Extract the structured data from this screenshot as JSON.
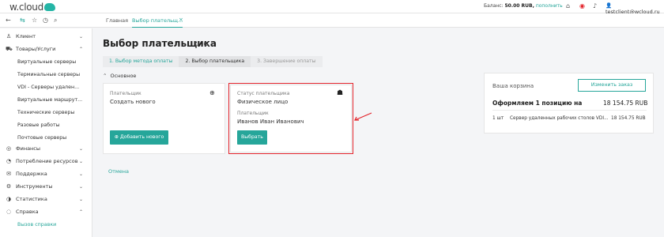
{
  "header": {
    "logo": "w.cloud",
    "balance_label": "Баланс:",
    "balance_value": "50.00 RUB,",
    "topup_link": "пополнить",
    "user_email": "testclient@wcloud.ru",
    "icons": [
      "home-icon",
      "warning-icon",
      "bell-icon",
      "user-icon"
    ]
  },
  "tabs": [
    {
      "label": "Главная"
    },
    {
      "label": "Выбор плательщ..."
    }
  ],
  "sidebar": {
    "sections": [
      {
        "label": "Клиент",
        "icon": "user-icon"
      },
      {
        "label": "Товары/Услуги",
        "icon": "cart-icon"
      },
      {
        "label": "Финансы",
        "icon": "coin-icon"
      },
      {
        "label": "Потребление ресурсов",
        "icon": "chart-icon"
      },
      {
        "label": "Поддержка",
        "icon": "support-icon"
      },
      {
        "label": "Инструменты",
        "icon": "gear-icon"
      },
      {
        "label": "Статистика",
        "icon": "stats-icon"
      },
      {
        "label": "Справка",
        "icon": "help-icon"
      }
    ],
    "services": [
      "Виртуальные серверы",
      "Терминальные серверы",
      "VDI - Серверы удален...",
      "Виртуальные маршрут...",
      "Технические серверы",
      "Разовые работы",
      "Почтовые серверы"
    ],
    "help_items": [
      "Вызов справки"
    ]
  },
  "main": {
    "title": "Выбор плательщика",
    "steps": [
      "1. Выбор метода оплаты",
      "2. Выбор плательщика",
      "3. Завершение оплаты"
    ],
    "section_label": "Основное",
    "card_new": {
      "payer_label": "Плательщик",
      "payer_value": "Создать нового",
      "add_button": "Добавить нового"
    },
    "card_existing": {
      "status_label": "Статус плательщика",
      "status_value": "Физическое лицо",
      "payer_label": "Плательщик",
      "payer_value": "Иванов Иван Иванович",
      "select_button": "Выбрать"
    },
    "cancel_link": "Отмена"
  },
  "cart": {
    "title": "Ваша корзина",
    "change_button": "Изменить заказ",
    "heading": "Оформляем 1 позицию на",
    "total": "18 154.75 RUB",
    "items": [
      {
        "qty": "1 шт",
        "name": "Сервер удаленных рабочих столов VDI...",
        "price": "18 154.75 RUB"
      }
    ]
  },
  "colors": {
    "accent": "#26a69a",
    "highlight": "#e3242b"
  }
}
